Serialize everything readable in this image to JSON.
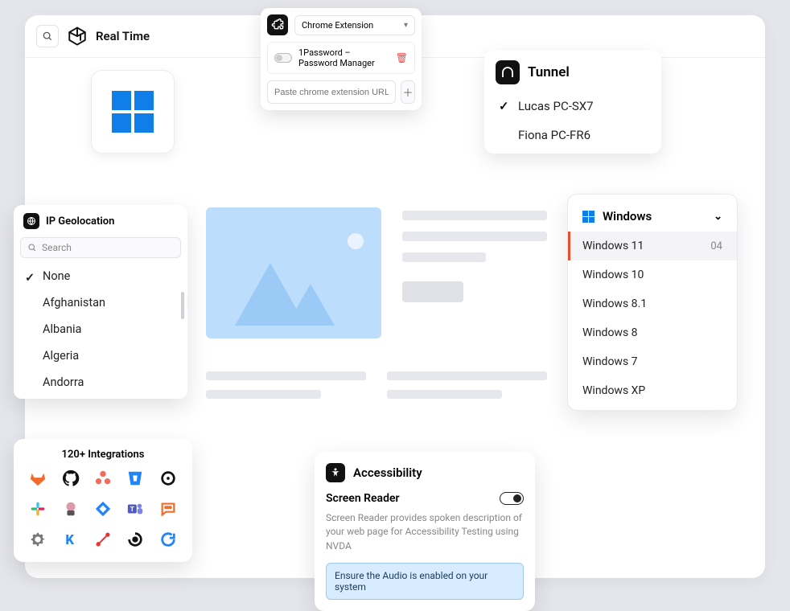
{
  "header": {
    "title": "Real Time"
  },
  "extension": {
    "dropdown_label": "Chrome Extension",
    "item_name": "1Password – Password Manager",
    "url_placeholder": "Paste chrome extension URL to add"
  },
  "tunnel": {
    "title": "Tunnel",
    "items": [
      {
        "label": "Lucas PC-SX7",
        "selected": true
      },
      {
        "label": "Fiona PC-FR6",
        "selected": false
      }
    ]
  },
  "geo": {
    "title": "IP Geolocation",
    "search_placeholder": "Search",
    "items": [
      {
        "label": "None",
        "selected": true
      },
      {
        "label": "Afghanistan",
        "selected": false
      },
      {
        "label": "Albania",
        "selected": false
      },
      {
        "label": "Algeria",
        "selected": false
      },
      {
        "label": "Andorra",
        "selected": false
      }
    ]
  },
  "windows": {
    "title": "Windows",
    "versions": [
      {
        "label": "Windows 11",
        "count": "04",
        "selected": true
      },
      {
        "label": "Windows 10",
        "selected": false
      },
      {
        "label": "Windows 8.1",
        "selected": false
      },
      {
        "label": "Windows 8",
        "selected": false
      },
      {
        "label": "Windows 7",
        "selected": false
      },
      {
        "label": "Windows XP",
        "selected": false
      }
    ]
  },
  "integrations": {
    "title": "120+ Integrations"
  },
  "accessibility": {
    "title": "Accessibility",
    "section_title": "Screen Reader",
    "description": "Screen Reader provides spoken description of your web page for Accessibility Testing using NVDA",
    "note": "Ensure the Audio is enabled on your system"
  }
}
